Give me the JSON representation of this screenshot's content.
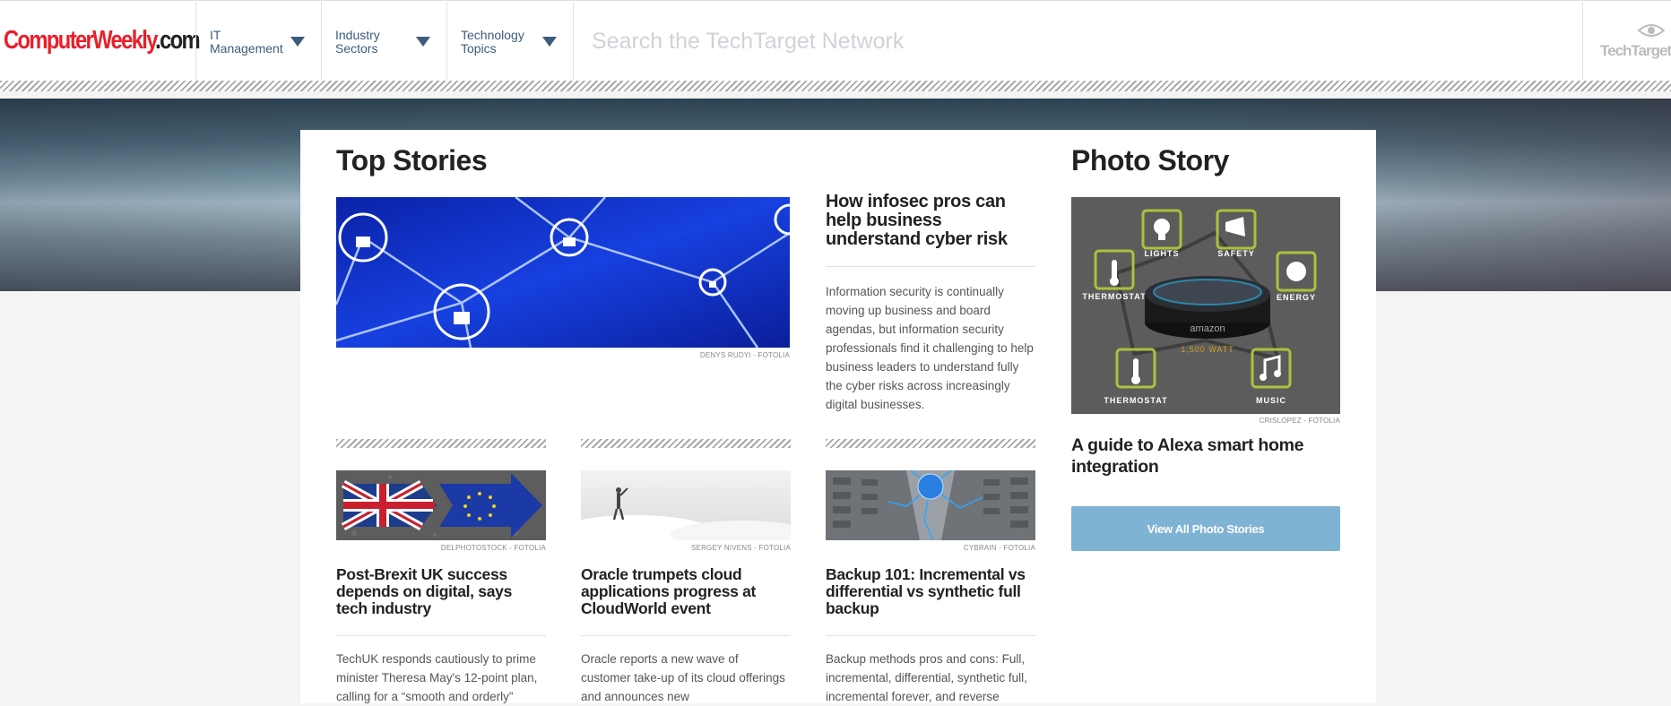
{
  "header": {
    "logo_part1": "ComputerWeekly",
    "logo_part2": ".com",
    "nav": [
      {
        "label": "IT Management"
      },
      {
        "label": "Industry Sectors"
      },
      {
        "label": "Technology Topics"
      }
    ],
    "search_placeholder": "Search the TechTarget Network",
    "techtarget_label": "TechTarget"
  },
  "top_stories": {
    "title": "Top Stories",
    "featured": {
      "image_credit": "DENYS RUDYI - FOTOLIA",
      "headline": "How infosec pros can help business understand cyber risk",
      "summary": "Information security is continually moving up business and board agendas, but information security professionals find it challenging to help business leaders to understand fully the cyber risks across increasingly digital businesses."
    },
    "stories": [
      {
        "image_credit": "DELPHOTOSTOCK - FOTOLIA",
        "headline": "Post-Brexit UK success depends on digital, says tech industry",
        "summary": "TechUK responds cautiously to prime minister Theresa May's 12-point plan, calling for a “smooth and orderly”"
      },
      {
        "image_credit": "SERGEY NIVENS - FOTOLIA",
        "headline": "Oracle trumpets cloud applications progress at CloudWorld event",
        "summary": "Oracle reports a new wave of customer take-up of its cloud offerings and announces new"
      },
      {
        "image_credit": "CYBRAIN - FOTOLIA",
        "headline": "Backup 101: Incremental vs differential vs synthetic full backup",
        "summary": "Backup methods pros and cons: Full, incremental, differential, synthetic full, incremental forever, and reverse"
      }
    ]
  },
  "photo_story": {
    "title": "Photo Story",
    "image_credit": "CRISLOPEZ - FOTOLIA",
    "image_labels": {
      "lights": "LIGHTS",
      "safety": "SAFETY",
      "thermostat_top": "THERMOSTAT",
      "energy": "ENERGY",
      "thermostat_bottom": "THERMOSTAT",
      "music": "MUSIC",
      "brand": "amazon",
      "watt": "1,500 WATT"
    },
    "headline": "A guide to Alexa smart home integration",
    "button_label": "View All Photo Stories"
  },
  "colors": {
    "logo_red": "#e8202a",
    "nav_text": "#3c5c7c",
    "button_bg": "#7fb3d3"
  }
}
